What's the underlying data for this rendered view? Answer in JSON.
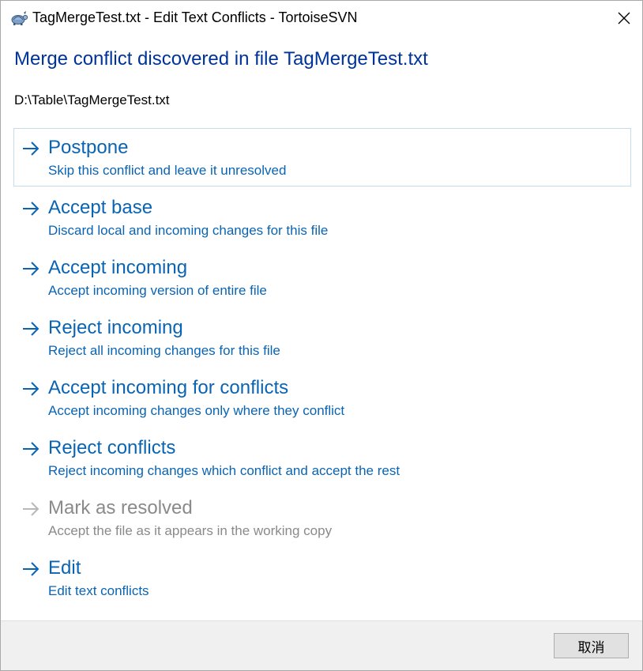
{
  "window": {
    "title": "TagMergeTest.txt - Edit Text Conflicts - TortoiseSVN",
    "app_icon": "tortoise-icon",
    "close_icon": "close-icon"
  },
  "main_instruction": "Merge conflict discovered in file TagMergeTest.txt",
  "file_path": "D:\\Table\\TagMergeTest.txt",
  "colors": {
    "heading": "#003399",
    "link": "#0a64b4",
    "disabled": "#8a8a8a",
    "focus_border": "#c5dcec",
    "footer_bg": "#f0f0f0"
  },
  "commands": [
    {
      "label": "Postpone",
      "desc": "Skip this conflict and leave it unresolved",
      "icon": "arrow-right-icon",
      "enabled": true,
      "focused": true
    },
    {
      "label": "Accept base",
      "desc": "Discard local and incoming changes for this file",
      "icon": "arrow-right-icon",
      "enabled": true
    },
    {
      "label": "Accept incoming",
      "desc": "Accept incoming version of entire file",
      "icon": "arrow-right-icon",
      "enabled": true
    },
    {
      "label": "Reject incoming",
      "desc": "Reject all incoming changes for this file",
      "icon": "arrow-right-icon",
      "enabled": true
    },
    {
      "label": "Accept incoming for conflicts",
      "desc": "Accept incoming changes only where they conflict",
      "icon": "arrow-right-icon",
      "enabled": true
    },
    {
      "label": "Reject conflicts",
      "desc": "Reject incoming changes which conflict and accept the rest",
      "icon": "arrow-right-icon",
      "enabled": true
    },
    {
      "label": "Mark as resolved",
      "desc": "Accept the file as it appears in the working copy",
      "icon": "arrow-right-icon",
      "enabled": false
    },
    {
      "label": "Edit",
      "desc": "Edit text conflicts",
      "icon": "arrow-right-icon",
      "enabled": true
    }
  ],
  "footer": {
    "cancel_label": "取消"
  }
}
